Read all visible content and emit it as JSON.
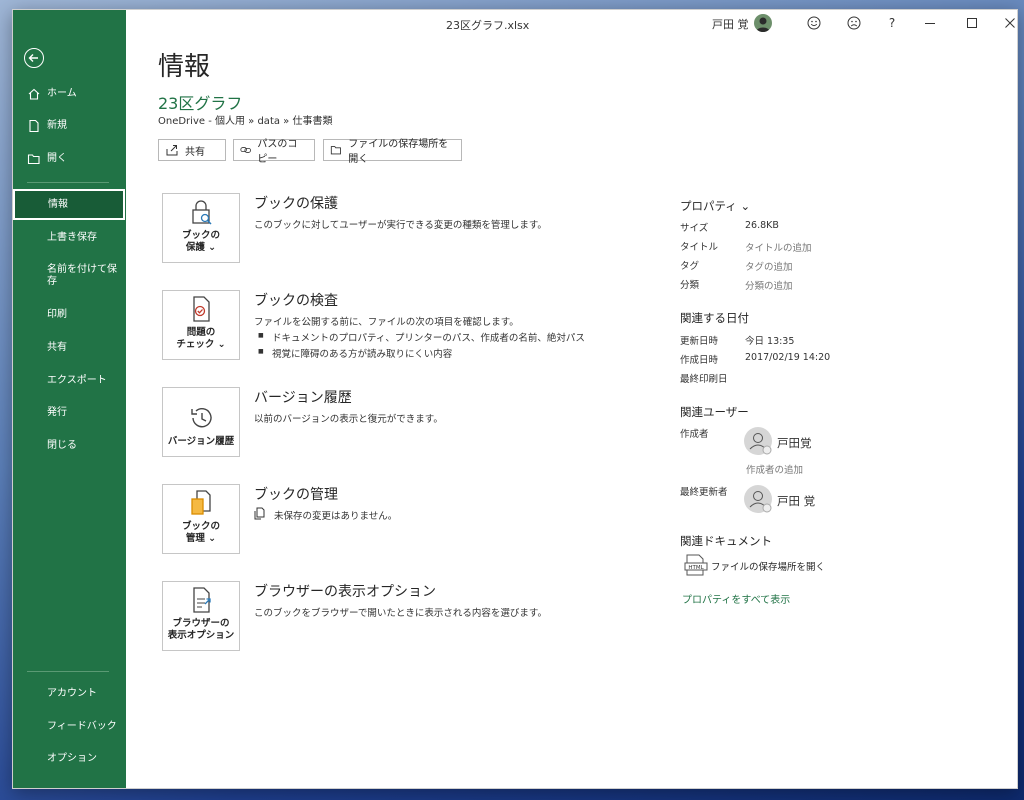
{
  "window": {
    "title": "23区グラフ.xlsx",
    "user_name": "戸田 覚"
  },
  "sidebar": {
    "items": [
      {
        "label": "ホーム",
        "icon": "home-icon"
      },
      {
        "label": "新規",
        "icon": "new-file-icon"
      },
      {
        "label": "開く",
        "icon": "folder-open-icon"
      },
      {
        "label": "情報"
      },
      {
        "label": "上書き保存"
      },
      {
        "label": "名前を付けて保存"
      },
      {
        "label": "印刷"
      },
      {
        "label": "共有"
      },
      {
        "label": "エクスポート"
      },
      {
        "label": "発行"
      },
      {
        "label": "閉じる"
      }
    ],
    "bottom_items": [
      {
        "label": "アカウント"
      },
      {
        "label": "フィードバック"
      },
      {
        "label": "オプション"
      }
    ]
  },
  "main": {
    "page_title": "情報",
    "doc_title": "23区グラフ",
    "breadcrumb": "OneDrive - 個人用 » data » 仕事書類",
    "actions": [
      {
        "label": "共有"
      },
      {
        "label": "パスのコピー"
      },
      {
        "label": "ファイルの保存場所を開く"
      }
    ],
    "sections": [
      {
        "tile_label": "ブックの\n保護 ⌄",
        "title": "ブックの保護",
        "desc": "このブックに対してユーザーが実行できる変更の種類を管理します。"
      },
      {
        "tile_label": "問題の\nチェック ⌄",
        "title": "ブックの検査",
        "desc": "ファイルを公開する前に、ファイルの次の項目を確認します。",
        "bullets": [
          "ドキュメントのプロパティ、プリンターのパス、作成者の名前、絶対パス",
          "視覚に障碍のある方が読み取りにくい内容"
        ]
      },
      {
        "tile_label": "バージョン履歴",
        "title": "バージョン履歴",
        "desc": "以前のバージョンの表示と復元ができます。"
      },
      {
        "tile_label": "ブックの\n管理 ⌄",
        "title": "ブックの管理",
        "desc": "未保存の変更はありません。"
      },
      {
        "tile_label": "ブラウザーの\n表示オプション",
        "title": "ブラウザーの表示オプション",
        "desc": "このブックをブラウザーで開いたときに表示される内容を選びます。"
      }
    ]
  },
  "properties": {
    "heading": "プロパティ ⌄",
    "rows": [
      {
        "key": "サイズ",
        "value": "26.8KB"
      },
      {
        "key": "タイトル",
        "value": "タイトルの追加"
      },
      {
        "key": "タグ",
        "value": "タグの追加"
      },
      {
        "key": "分類",
        "value": "分類の追加"
      }
    ],
    "dates_heading": "関連する日付",
    "dates": [
      {
        "key": "更新日時",
        "value": "今日 13:35"
      },
      {
        "key": "作成日時",
        "value": "2017/02/19 14:20"
      },
      {
        "key": "最終印刷日",
        "value": ""
      }
    ],
    "people_heading": "関連ユーザー",
    "author_key": "作成者",
    "author_name": "戸田覚",
    "add_author": "作成者の追加",
    "last_modified_key": "最終更新者",
    "last_modified_name": "戸田 覚",
    "docs_heading": "関連ドキュメント",
    "open_location": "ファイルの保存場所を開く",
    "show_all": "プロパティをすべて表示"
  }
}
